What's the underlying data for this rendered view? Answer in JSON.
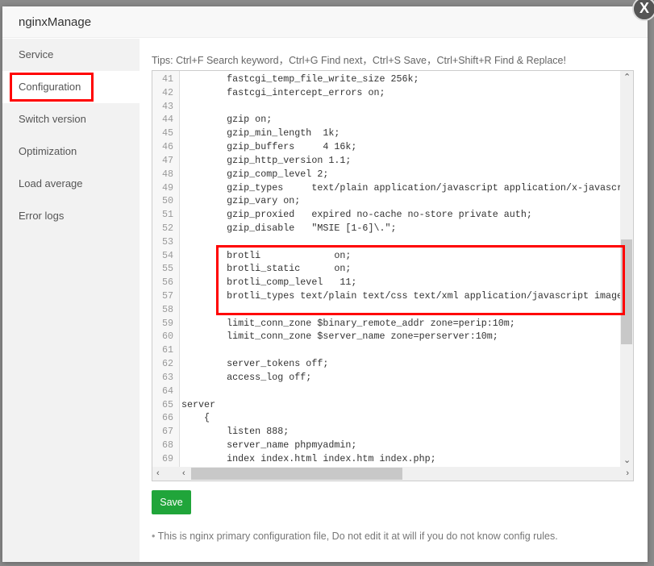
{
  "dialog": {
    "title": "nginxManage",
    "close_label": "X"
  },
  "sidebar": {
    "items": [
      {
        "label": "Service"
      },
      {
        "label": "Configuration",
        "active": true
      },
      {
        "label": "Switch version"
      },
      {
        "label": "Optimization"
      },
      {
        "label": "Load average"
      },
      {
        "label": "Error logs"
      }
    ]
  },
  "tips": "Tips:  Ctrl+F Search keyword，Ctrl+G Find next，Ctrl+S Save，Ctrl+Shift+R Find & Replace!",
  "editor": {
    "lines": [
      {
        "n": "41",
        "t": "        fastcgi_temp_file_write_size 256k;"
      },
      {
        "n": "42",
        "t": "        fastcgi_intercept_errors on;"
      },
      {
        "n": "43",
        "t": ""
      },
      {
        "n": "44",
        "t": "        gzip on;"
      },
      {
        "n": "45",
        "t": "        gzip_min_length  1k;"
      },
      {
        "n": "46",
        "t": "        gzip_buffers     4 16k;"
      },
      {
        "n": "47",
        "t": "        gzip_http_version 1.1;"
      },
      {
        "n": "48",
        "t": "        gzip_comp_level 2;"
      },
      {
        "n": "49",
        "t": "        gzip_types     text/plain application/javascript application/x-javascript"
      },
      {
        "n": "50",
        "t": "        gzip_vary on;"
      },
      {
        "n": "51",
        "t": "        gzip_proxied   expired no-cache no-store private auth;"
      },
      {
        "n": "52",
        "t": "        gzip_disable   \"MSIE [1-6]\\.\";"
      },
      {
        "n": "53",
        "t": ""
      },
      {
        "n": "54",
        "t": "        brotli             on;"
      },
      {
        "n": "55",
        "t": "        brotli_static      on;"
      },
      {
        "n": "56",
        "t": "        brotli_comp_level   11;"
      },
      {
        "n": "57",
        "t": "        brotli_types text/plain text/css text/xml application/javascript image"
      },
      {
        "n": "58",
        "t": ""
      },
      {
        "n": "59",
        "t": "        limit_conn_zone $binary_remote_addr zone=perip:10m;"
      },
      {
        "n": "60",
        "t": "        limit_conn_zone $server_name zone=perserver:10m;"
      },
      {
        "n": "61",
        "t": ""
      },
      {
        "n": "62",
        "t": "        server_tokens off;"
      },
      {
        "n": "63",
        "t": "        access_log off;"
      },
      {
        "n": "64",
        "t": ""
      },
      {
        "n": "65",
        "t": "server"
      },
      {
        "n": "66",
        "t": "    {"
      },
      {
        "n": "67",
        "t": "        listen 888;"
      },
      {
        "n": "68",
        "t": "        server_name phpmyadmin;"
      },
      {
        "n": "69",
        "t": "        index index.html index.htm index.php;"
      }
    ]
  },
  "save_label": "Save",
  "note": "This is nginx primary configuration file, Do not edit it at will if you do not know config rules.",
  "colors": {
    "accent": "#20a53a",
    "highlight": "#ff0000"
  }
}
